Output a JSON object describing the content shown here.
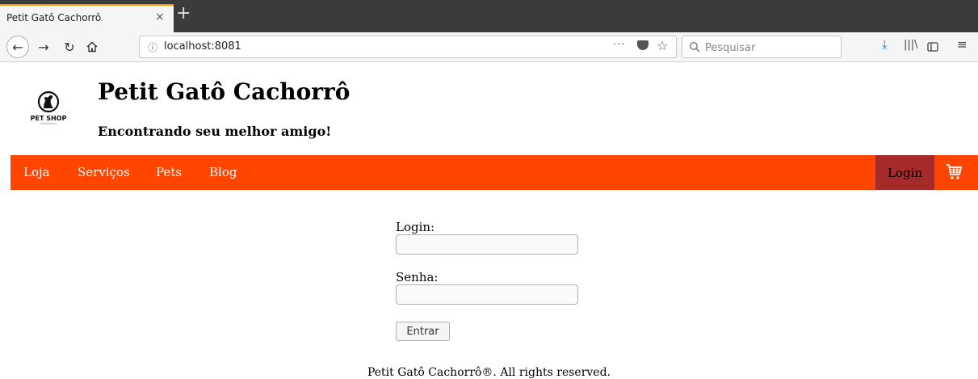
{
  "browser": {
    "tab_title": "Petit Gatô Cachorrô",
    "tab_close": "×",
    "new_tab": "+",
    "url_info": "ⓘ",
    "url": "localhost:8081",
    "url_more": "···",
    "search_placeholder": "Pesquisar"
  },
  "site": {
    "title": "Petit Gatô Cachorrô",
    "subtitle": "Encontrando seu melhor amigo!",
    "logo_text": "PET SHOP"
  },
  "menu": {
    "items": [
      "Loja",
      "Serviços",
      "Pets",
      "Blog"
    ],
    "login": "Login"
  },
  "form": {
    "login_label": "Login:",
    "password_label": "Senha:",
    "submit_label": "Entrar"
  },
  "footer": {
    "text": "Petit Gatô Cachorrô®. All rights reserved."
  },
  "colors": {
    "menu_bg": "#ff4500",
    "login_bg": "#a52a2a"
  }
}
